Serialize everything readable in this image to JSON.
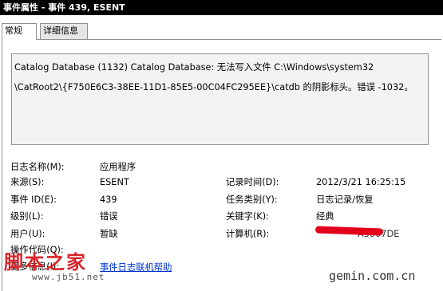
{
  "window": {
    "title": "事件属性 - 事件 439, ESENT"
  },
  "tabs": [
    {
      "label": "常规",
      "active": true
    },
    {
      "label": "详细信息",
      "active": false
    }
  ],
  "description": {
    "line1": "Catalog Database (1132) Catalog Database: 无法写入文件 C:\\Windows\\system32",
    "line2": "\\CatRoot2\\{F750E6C3-38EE-11D1-85E5-00C04FC295EE}\\catdb 的阴影标头。错误 -1032。"
  },
  "fields": {
    "log_name": {
      "label": "日志名称(M):",
      "value": "应用程序"
    },
    "source": {
      "label": "来源(S):",
      "value": "ESENT"
    },
    "event_id": {
      "label": "事件 ID(E):",
      "value": "439"
    },
    "level": {
      "label": "级别(L):",
      "value": "错误"
    },
    "user": {
      "label": "用户(U):",
      "value": "暂缺"
    },
    "opcode": {
      "label": "操作代码(O):",
      "value": ""
    },
    "more_info": {
      "label": "更多信息(I):",
      "link": "事件日志联机帮助"
    },
    "logged": {
      "label": "记录时间(D):",
      "value": "2012/3/21 16:25:15"
    },
    "task": {
      "label": "任务类别(Y):",
      "value": "日志记录/恢复"
    },
    "keywords": {
      "label": "关键字(K):",
      "value": "经典"
    },
    "computer": {
      "label": "计算机(R):",
      "value": "A5007DE"
    }
  },
  "watermarks": {
    "site_cn": "脚本之家",
    "site_url": "www.jb51.net",
    "gemin": "gemin.com.cn"
  },
  "colors": {
    "titlebar_bg": "#000000",
    "redaction": "#e3001b",
    "link": "#0033cc"
  }
}
